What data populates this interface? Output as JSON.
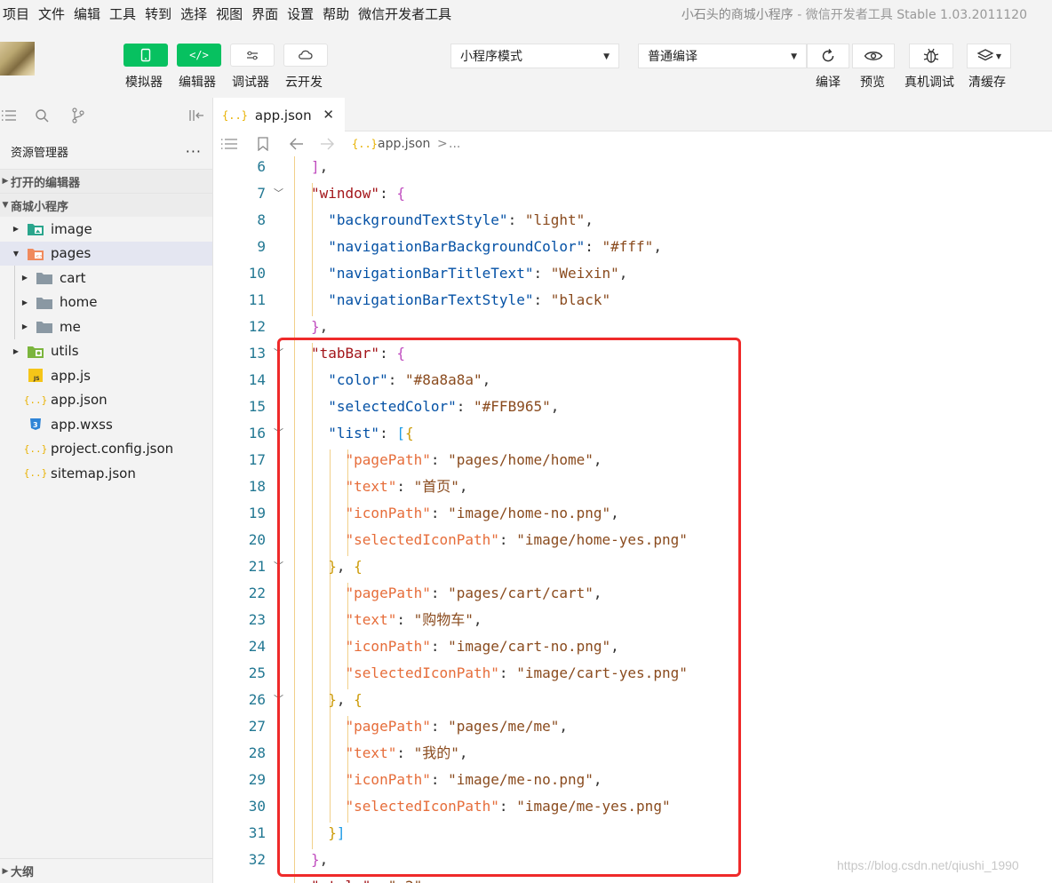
{
  "menu": {
    "items": [
      "项目",
      "文件",
      "编辑",
      "工具",
      "转到",
      "选择",
      "视图",
      "界面",
      "设置",
      "帮助",
      "微信开发者工具"
    ],
    "title_app": "小石头的商城小程序",
    "title_rest": "- 微信开发者工具 Stable 1.03.2011120"
  },
  "toolbar": {
    "simulator": "模拟器",
    "editor": "编辑器",
    "debugger": "调试器",
    "cloud": "云开发",
    "mode_select": "小程序模式",
    "compile_select": "普通编译",
    "compile": "编译",
    "preview": "预览",
    "remote_debug": "真机调试",
    "clear_cache": "清缓存"
  },
  "sidebar": {
    "header": "资源管理器",
    "open_editors": "打开的编辑器",
    "project": "商城小程序",
    "tree": [
      {
        "label": "image",
        "kind": "folder-img"
      },
      {
        "label": "pages",
        "kind": "folder-pages"
      },
      {
        "label": "cart",
        "kind": "folder"
      },
      {
        "label": "home",
        "kind": "folder"
      },
      {
        "label": "me",
        "kind": "folder"
      },
      {
        "label": "utils",
        "kind": "folder-utils"
      },
      {
        "label": "app.js",
        "kind": "js"
      },
      {
        "label": "app.json",
        "kind": "json"
      },
      {
        "label": "app.wxss",
        "kind": "css"
      },
      {
        "label": "project.config.json",
        "kind": "json"
      },
      {
        "label": "sitemap.json",
        "kind": "json"
      }
    ],
    "outline": "大纲"
  },
  "editor": {
    "tab_label": "app.json",
    "breadcrumb": "app.json",
    "breadcrumb_more": "...",
    "line_numbers": [
      "6",
      "7",
      "8",
      "9",
      "10",
      "11",
      "12",
      "13",
      "14",
      "15",
      "16",
      "17",
      "18",
      "19",
      "20",
      "21",
      "22",
      "23",
      "24",
      "25",
      "26",
      "27",
      "28",
      "29",
      "30",
      "31",
      "32"
    ]
  },
  "watermark": "https://blog.csdn.net/qiushi_1990",
  "colors": {
    "accent_green": "#07c160",
    "highlight_box": "#ef2a2a"
  }
}
